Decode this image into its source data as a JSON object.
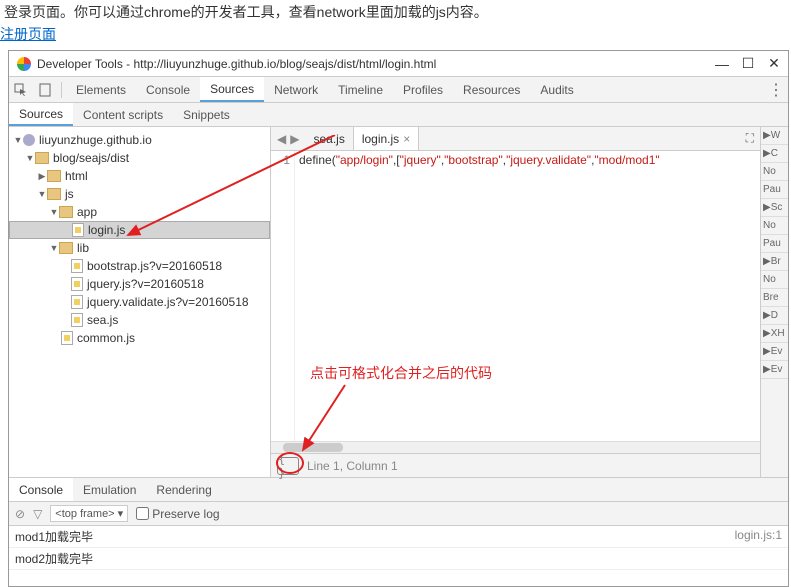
{
  "page": {
    "intro": "登录页面。你可以通过chrome的开发者工具，查看network里面加载的js内容。",
    "link": "注册页面"
  },
  "window": {
    "title": "Developer Tools - http://liuyunzhuge.github.io/blog/seajs/dist/html/login.html"
  },
  "mainTabs": [
    "Elements",
    "Console",
    "Sources",
    "Network",
    "Timeline",
    "Profiles",
    "Resources",
    "Audits"
  ],
  "mainTabActive": "Sources",
  "subTabs": [
    "Sources",
    "Content scripts",
    "Snippets"
  ],
  "subTabActive": "Sources",
  "tree": {
    "domain": "liuyunzhuge.github.io",
    "path1": "blog/seajs/dist",
    "html": "html",
    "js": "js",
    "app": "app",
    "loginjs": "login.js",
    "lib": "lib",
    "bootstrap": "bootstrap.js?v=20160518",
    "jquery": "jquery.js?v=20160518",
    "validate": "jquery.validate.js?v=20160518",
    "sea": "sea.js",
    "common": "common.js"
  },
  "editor": {
    "tabs": [
      {
        "name": "sea.js",
        "active": false,
        "close": false
      },
      {
        "name": "login.js",
        "active": true,
        "close": true
      }
    ],
    "navSymbols": {
      "left": "◀",
      "right": "▶"
    },
    "lineNum": "1",
    "code": {
      "fn": "define",
      "s1": "\"app/login\"",
      "s2": "\"jquery\"",
      "s3": "\"bootstrap\"",
      "s4": "\"jquery.validate\"",
      "s5": "\"mod/mod1\""
    },
    "status": "Line 1, Column 1",
    "prettyGlyph": "{ }"
  },
  "rightPanel": [
    "▶W",
    "▶C",
    "No",
    "Pau",
    "▶Sc",
    "No",
    "Pau",
    "▶Br",
    "No",
    "Bre",
    "▶D",
    "▶XH",
    "▶Ev",
    "▶Ev"
  ],
  "bottomTabs": [
    "Console",
    "Emulation",
    "Rendering"
  ],
  "bottomTabActive": "Console",
  "console": {
    "frameSel": "<top frame>",
    "preserve": "Preserve log",
    "msgs": [
      {
        "text": "mod1加载完毕",
        "src": "login.js:1"
      },
      {
        "text": "mod2加载完毕",
        "src": ""
      }
    ]
  },
  "annotations": {
    "text1": "点击可格式化合并之后的代码"
  }
}
